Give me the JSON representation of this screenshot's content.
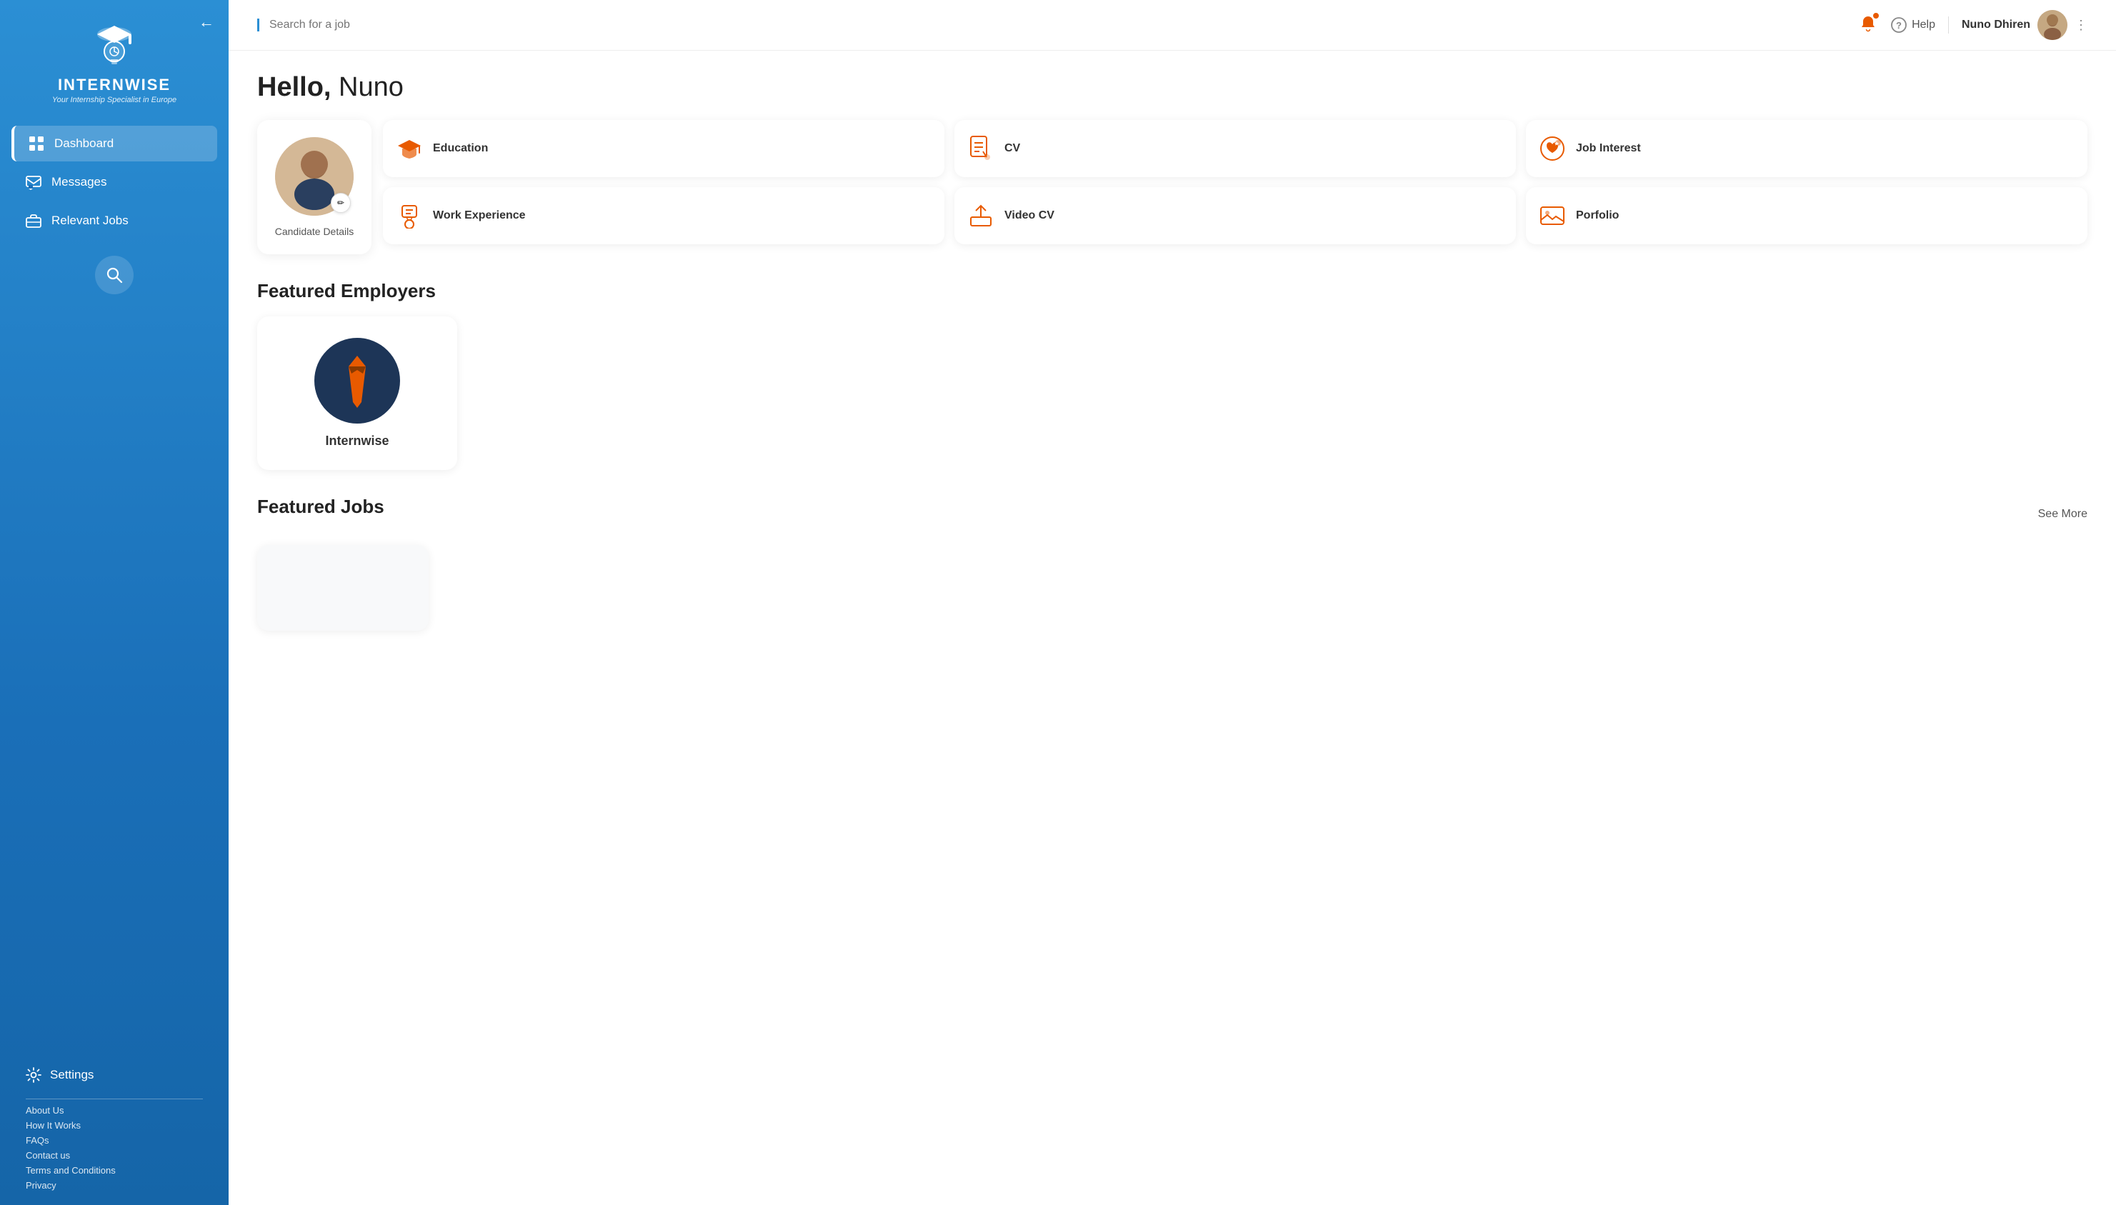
{
  "sidebar": {
    "back_btn": "←",
    "logo_text": "INTERNWISE",
    "logo_sub": "Your Internship Specialist in Europe",
    "nav_items": [
      {
        "id": "dashboard",
        "label": "Dashboard",
        "active": true
      },
      {
        "id": "messages",
        "label": "Messages",
        "active": false
      },
      {
        "id": "relevant-jobs",
        "label": "Relevant Jobs",
        "active": false
      }
    ],
    "settings_label": "Settings",
    "links": [
      "About Us",
      "How It Works",
      "FAQs",
      "Contact us",
      "Terms and Conditions",
      "Privacy"
    ]
  },
  "header": {
    "search_placeholder": "Search for a job",
    "help_label": "Help",
    "user_name": "Nuno Dhiren",
    "notification_icon": "🔔",
    "help_icon": "?"
  },
  "greeting": {
    "bold": "Hello,",
    "light": " Nuno"
  },
  "profile_card": {
    "label": "Candidate Details",
    "edit_icon": "✏"
  },
  "feature_cards": [
    {
      "id": "education",
      "icon": "🎓",
      "label": "Education"
    },
    {
      "id": "cv",
      "icon": "📄",
      "label": "CV"
    },
    {
      "id": "job-interest",
      "icon": "💝",
      "label": "Job Interest"
    },
    {
      "id": "work-experience",
      "icon": "🏅",
      "label": "Work Experience"
    },
    {
      "id": "video-cv",
      "icon": "⬆",
      "label": "Video CV"
    },
    {
      "id": "portfolio",
      "icon": "🖼",
      "label": "Porfolio"
    }
  ],
  "featured_employers": {
    "title": "Featured Employers",
    "items": [
      {
        "id": "internwise",
        "name": "Internwise",
        "icon": "👔"
      }
    ]
  },
  "featured_jobs": {
    "title": "Featured Jobs",
    "see_more": "See More",
    "items": []
  }
}
